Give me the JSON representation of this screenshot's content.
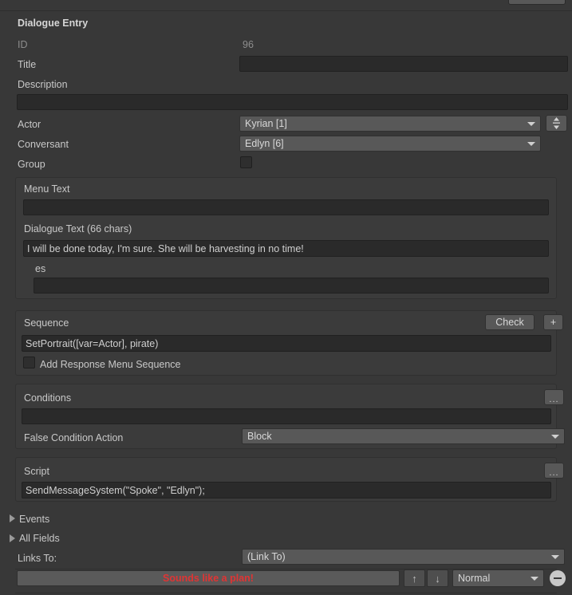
{
  "window": {
    "title": "Dialogue Entry",
    "background": "#383838",
    "accent_red": "#e03434"
  },
  "fields": {
    "id_label": "ID",
    "id_value": "96",
    "title_label": "Title",
    "title_value": "",
    "title_placeholder": "",
    "description_label": "Description",
    "description_value": "",
    "actor_label": "Actor",
    "actor_value": "Kyrian [1]",
    "conversant_label": "Conversant",
    "conversant_value": "Edlyn [6]",
    "group_label": "Group",
    "group_checked": false
  },
  "text_section": {
    "menu_text_label": "Menu Text",
    "menu_text_value": "",
    "dialogue_text_label": "Dialogue Text (66 chars)",
    "dialogue_text_value": "I will be done today, I'm sure. She will be harvesting in no time!",
    "localization_label": "es",
    "localization_value": ""
  },
  "sequence_section": {
    "label": "Sequence",
    "check_button": "Check",
    "plus_button": "+",
    "value": "SetPortrait([var=Actor], pirate)",
    "add_response_menu_label": "Add Response Menu Sequence",
    "add_response_menu_checked": false
  },
  "conditions_section": {
    "label": "Conditions",
    "menu_button": "...",
    "value": "",
    "false_condition_action_label": "False Condition Action",
    "false_condition_action_value": "Block"
  },
  "script_section": {
    "label": "Script",
    "menu_button": "...",
    "value": "SendMessageSystem(\"Spoke\", \"Edlyn\");"
  },
  "foldouts": {
    "events_label": "Events",
    "all_fields_label": "All Fields"
  },
  "links": {
    "links_to_label": "Links To:",
    "link_to_dropdown_value": "(Link To)",
    "link_entry_text": "Sounds like a plan!",
    "move_up_icon": "↑",
    "move_down_icon": "↓",
    "priority_value": "Normal",
    "remove_icon": "minus"
  }
}
